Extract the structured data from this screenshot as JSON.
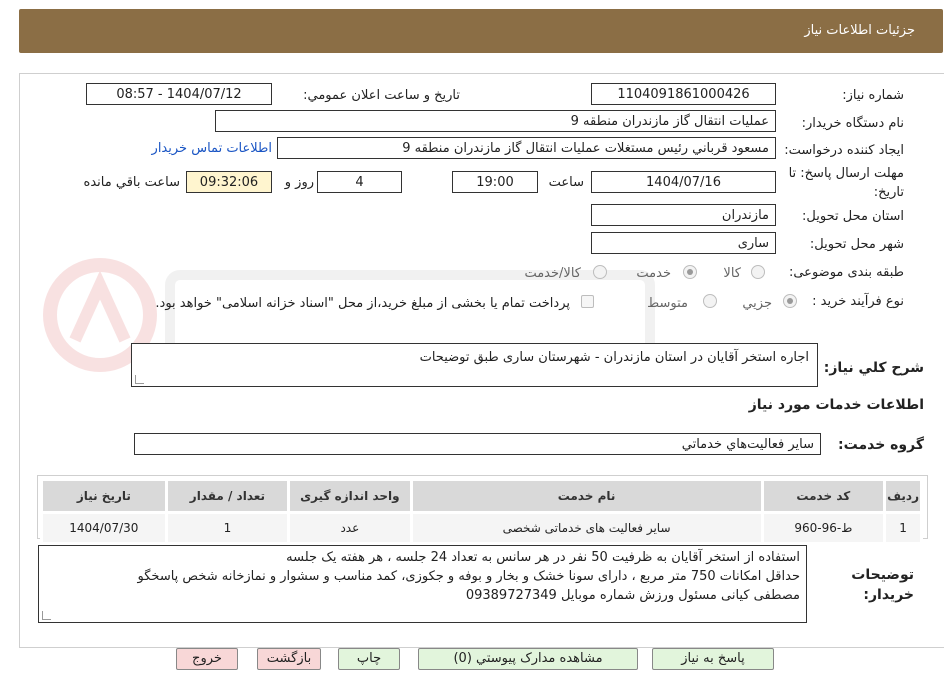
{
  "header": {
    "title": "جزئیات اطلاعات نیاز"
  },
  "form": {
    "need_number_label": "شماره نیاز:",
    "need_number": "1104091861000426",
    "announce_label": "تاریخ و ساعت اعلان عمومي:",
    "announce_value": "1404/07/12 - 08:57",
    "buyer_org_label": "نام دستگاه خريدار:",
    "buyer_org": "عمليات انتقال گاز مازندران منطقه 9",
    "requester_label": "ايجاد کننده درخواست:",
    "requester": "مسعود قرباني رئيس مستغلات عمليات انتقال گاز مازندران منطقه 9",
    "contact_link": "اطلاعات تماس خريدار",
    "deadline_label_1": "مهلت ارسال پاسخ: تا",
    "deadline_label_2": "تاريخ:",
    "deadline_date": "1404/07/16",
    "time_label": "ساعت",
    "deadline_time": "19:00",
    "days": "4",
    "days_label": "روز و",
    "remaining_time": "09:32:06",
    "remaining_label": "ساعت باقي مانده",
    "province_label": "استان محل تحويل:",
    "province": "مازندران",
    "city_label": "شهر محل تحويل:",
    "city": "ساری",
    "category_label": "طبقه بندی موضوعی:",
    "category_options": [
      "کالا",
      "خدمت",
      "کالا/خدمت"
    ],
    "process_label": "نوع فرآيند خريد :",
    "process_options": [
      "جزيي",
      "متوسط"
    ],
    "payment_note": "پرداخت تمام يا بخشی از مبلغ خريد،از محل \"اسناد خزانه اسلامی\" خواهد بود."
  },
  "summary": {
    "label": "شرح کلي نياز:",
    "text": "اجاره استخر  آقایان در استان مازندران - شهرستان ساری طبق توضیحات"
  },
  "services": {
    "section_title": "اطلاعات خدمات مورد نياز",
    "group_label": "گروه خدمت:",
    "group_value": "ساير فعاليت‌هاي خدماتي",
    "columns": [
      "رديف",
      "کد خدمت",
      "نام خدمت",
      "واحد اندازه گيری",
      "تعداد / مقدار",
      "تاريخ نياز"
    ],
    "rows": [
      [
        "1",
        "ط-96-960",
        "سایر فعالیت های خدماتی شخصی",
        "عدد",
        "1",
        "1404/07/30"
      ]
    ]
  },
  "buyer_notes": {
    "label_1": "توضيحات",
    "label_2": "خريدار:",
    "lines": [
      "استفاده از استخر آقایان به ظرفیت 50 نفر در هر سانس به تعداد 24 جلسه ، هر هفته یک جلسه",
      "حداقل امکانات 750 متر مربع ، دارای سونا خشک و بخار و بوفه و جکوزی، کمد مناسب و سشوار و نمازخانه  شخص پاسخگو",
      "مصطفی کیانی مسئول ورزش شماره موبایل 09389727349"
    ]
  },
  "buttons": {
    "reply": "پاسخ به نياز",
    "view_docs": "مشاهده مدارک پيوستي (0)",
    "print": "چاپ",
    "back": "بازگشت",
    "exit": "خروج"
  },
  "colors": {
    "header_bg": "#8b6e45",
    "link": "#1a55c4",
    "highlight": "#fff5cf",
    "button_green": "#e2f5dc",
    "button_pink": "#f8d7d7"
  }
}
